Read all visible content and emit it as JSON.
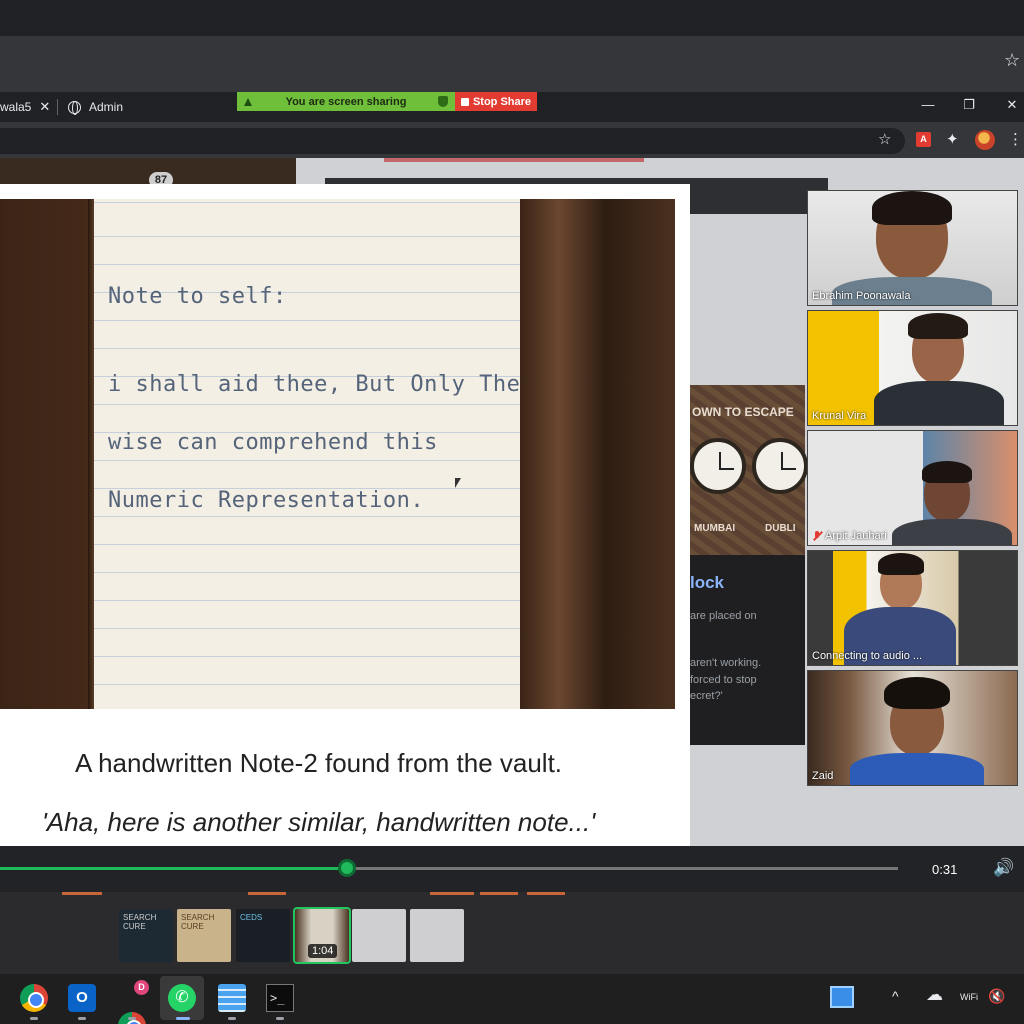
{
  "browser": {
    "tabs": [
      {
        "label": "wala5",
        "close": "✕"
      },
      {
        "label": "Admin"
      }
    ],
    "screenshare": {
      "status": "You are screen sharing",
      "stop": "Stop Share"
    },
    "window_controls": {
      "minimize": "—",
      "restore": "❐",
      "close": "✕"
    },
    "toolbar": {
      "bookmark": "☆",
      "extensions": "✦",
      "menu": "⋮",
      "pdf": "A"
    }
  },
  "page": {
    "badge": "87"
  },
  "background_card": {
    "title": "OWN TO ESCAPE",
    "cities": [
      "MUMBAI",
      "DUBLI"
    ],
    "heading": "lock",
    "lines": [
      "are placed on",
      "aren't working.",
      "forced to stop",
      "ecret?'"
    ]
  },
  "slide": {
    "note_lines": [
      "Note to self:",
      "i shall aid thee, But Only The",
      "wise can comprehend this",
      "Numeric Representation."
    ],
    "caption": "A handwritten Note-2 found from the vault.",
    "quote": "'Aha, here is another similar, handwritten note...'"
  },
  "participants": [
    {
      "name": "Ebrahim Poonawala",
      "muted": false
    },
    {
      "name": "Krunal Vira",
      "muted": false
    },
    {
      "name": "Arpit Jauhari",
      "muted": true
    },
    {
      "name": "Connecting to audio ...",
      "muted": false
    },
    {
      "name": "Zaid",
      "muted": false
    }
  ],
  "player": {
    "progress": 0.386,
    "time": "0:31",
    "volume_icon": "🔊"
  },
  "thumbnails": [
    {
      "label": "SEARCH CURE"
    },
    {
      "label": "SEARCH CURE"
    },
    {
      "label": "CEDS"
    },
    {
      "label": "1:04",
      "selected": true
    },
    {
      "label": ""
    },
    {
      "label": ""
    }
  ],
  "taskbar": {
    "chrome_badge": "D",
    "tray": {
      "chevron": "^",
      "cloud": "☁",
      "wifi": "WiFi",
      "volume": "🔇"
    }
  },
  "colors": {
    "share_green": "#6fbf3a",
    "stop_red": "#e23c32",
    "progress_green": "#1fb85a"
  }
}
